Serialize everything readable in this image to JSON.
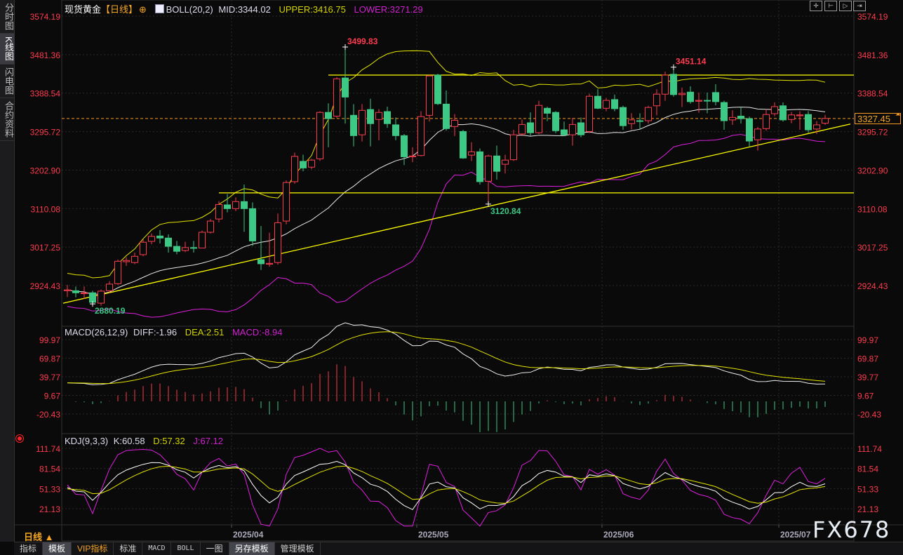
{
  "sidebar": {
    "tabs": [
      {
        "label": "分时图",
        "active": false
      },
      {
        "label": "K线图",
        "active": true
      },
      {
        "label": "闪电图",
        "active": false
      },
      {
        "label": "合约资料",
        "active": false
      }
    ]
  },
  "header": {
    "symbol": "现货黄金",
    "period_tag": "【日线】",
    "boll": {
      "name": "BOLL(20,2)",
      "mid": "MID:3344.02",
      "upper": "UPPER:3416.75",
      "lower": "LOWER:3271.29"
    },
    "macd": {
      "name": "MACD(26,12,9)",
      "diff": "DIFF:-1.96",
      "dea": "DEA:2.51",
      "macd": "MACD:-8.94"
    },
    "kdj": {
      "name": "KDJ(9,3,3)",
      "k": "K:60.58",
      "d": "D:57.32",
      "j": "J:67.12"
    }
  },
  "toolbar": {
    "icons": [
      "crosshair-icon",
      "zoom-left-icon",
      "zoom-right-icon",
      "move-right-icon"
    ]
  },
  "current_price": "3327.45",
  "period_label": "日线 ▲",
  "watermark": "FX678",
  "bottom_tabs": [
    {
      "label": "指标",
      "style": ""
    },
    {
      "label": "模板",
      "style": "hl"
    },
    {
      "label": "VIP指标",
      "style": "vip"
    },
    {
      "label": "标准",
      "style": ""
    },
    {
      "label": "MACD",
      "style": "mono"
    },
    {
      "label": "BOLL",
      "style": "mono"
    },
    {
      "label": "一图",
      "style": ""
    },
    {
      "label": "另存模板",
      "style": "hl"
    },
    {
      "label": "管理模板",
      "style": ""
    }
  ],
  "colors": {
    "up": "#ff3b4e",
    "down": "#3cc985",
    "axis_text": "#ff3b4e",
    "boll_mid": "#e8e8e8",
    "boll_upper": "#e6e600",
    "boll_lower": "#e020e0",
    "trendline": "#ffff00",
    "current_line": "#f59a23",
    "kdj_k": "#ffffff",
    "kdj_d": "#e6e600",
    "kdj_j": "#e020e0"
  },
  "chart_data": [
    {
      "type": "candlestick",
      "title": "现货黄金 日线",
      "y_ticks": [
        "3574.19",
        "3481.36",
        "3388.54",
        "3295.72",
        "3202.90",
        "3110.08",
        "3017.25",
        "2924.43"
      ],
      "x_labels": [
        {
          "index": 20,
          "label": "2025/04"
        },
        {
          "index": 42,
          "label": "2025/05"
        },
        {
          "index": 64,
          "label": "2025/06"
        },
        {
          "index": 85,
          "label": "2025/07"
        }
      ],
      "ohlc": [
        [
          2912,
          2926,
          2897,
          2914
        ],
        [
          2912,
          2922,
          2896,
          2907
        ],
        [
          2905,
          2922,
          2892,
          2907
        ],
        [
          2907,
          2912,
          2880.19,
          2884
        ],
        [
          2882,
          2915,
          2876,
          2911
        ],
        [
          2912,
          2935,
          2906,
          2928
        ],
        [
          2929,
          2987,
          2926,
          2983
        ],
        [
          2982,
          2993,
          2972,
          2985
        ],
        [
          2980,
          3004,
          2976,
          2995
        ],
        [
          2999,
          3036,
          2995,
          3029
        ],
        [
          3031,
          3050,
          3024,
          3043
        ],
        [
          3044,
          3058,
          3026,
          3039
        ],
        [
          3039,
          3048,
          3004,
          3019
        ],
        [
          3019,
          3032,
          3000,
          3007
        ],
        [
          3009,
          3030,
          3005,
          3016
        ],
        [
          3016,
          3032,
          3004,
          3015
        ],
        [
          3015,
          3057,
          3015,
          3053
        ],
        [
          3053,
          3085,
          3050,
          3080
        ],
        [
          3085,
          3128,
          3077,
          3120
        ],
        [
          3119,
          3145,
          3101,
          3110
        ],
        [
          3110,
          3137,
          3104,
          3127
        ],
        [
          3127,
          3168,
          3054,
          3110
        ],
        [
          3110,
          3125,
          3020,
          3032
        ],
        [
          2987,
          3068,
          2962,
          2977
        ],
        [
          2976,
          3052,
          2970,
          2978
        ],
        [
          2980,
          3098,
          2975,
          3076
        ],
        [
          3080,
          3178,
          3072,
          3173
        ],
        [
          3175,
          3245,
          3170,
          3236
        ],
        [
          3224,
          3240,
          3200,
          3208
        ],
        [
          3210,
          3230,
          3205,
          3227
        ],
        [
          3230,
          3345,
          3225,
          3342
        ],
        [
          3342,
          3364,
          3258,
          3327
        ],
        [
          3333,
          3427,
          3328,
          3423
        ],
        [
          3425,
          3499.83,
          3315,
          3379
        ],
        [
          3335,
          3362,
          3260,
          3286
        ],
        [
          3288,
          3362,
          3272,
          3347
        ],
        [
          3349,
          3375,
          3260,
          3315
        ],
        [
          3325,
          3350,
          3275,
          3342
        ],
        [
          3344,
          3356,
          3305,
          3315
        ],
        [
          3312,
          3330,
          3275,
          3286
        ],
        [
          3286,
          3290,
          3215,
          3235
        ],
        [
          3235,
          3258,
          3222,
          3237
        ],
        [
          3238,
          3345,
          3236,
          3332
        ],
        [
          3335,
          3432,
          3320,
          3430
        ],
        [
          3432,
          3435,
          3360,
          3363
        ],
        [
          3362,
          3395,
          3298,
          3303
        ],
        [
          3308,
          3338,
          3285,
          3323
        ],
        [
          3296,
          3300,
          3230,
          3232
        ],
        [
          3239,
          3270,
          3225,
          3247
        ],
        [
          3247,
          3255,
          3168,
          3175
        ],
        [
          3176,
          3240,
          3120.84,
          3237
        ],
        [
          3237,
          3262,
          3180,
          3200
        ],
        [
          3217,
          3240,
          3195,
          3227
        ],
        [
          3228,
          3300,
          3225,
          3288
        ],
        [
          3290,
          3325,
          3285,
          3313
        ],
        [
          3317,
          3342,
          3286,
          3293
        ],
        [
          3293,
          3370,
          3290,
          3359
        ],
        [
          3352,
          3356,
          3321,
          3340
        ],
        [
          3342,
          3345,
          3292,
          3298
        ],
        [
          3300,
          3320,
          3285,
          3288
        ],
        [
          3288,
          3329,
          3262,
          3313
        ],
        [
          3317,
          3330,
          3282,
          3288
        ],
        [
          3296,
          3387,
          3292,
          3381
        ],
        [
          3381,
          3398,
          3350,
          3352
        ],
        [
          3352,
          3377,
          3345,
          3371
        ],
        [
          3373,
          3385,
          3345,
          3351
        ],
        [
          3354,
          3358,
          3300,
          3310
        ],
        [
          3315,
          3340,
          3301,
          3324
        ],
        [
          3322,
          3340,
          3302,
          3321
        ],
        [
          3322,
          3358,
          3315,
          3354
        ],
        [
          3358,
          3398,
          3335,
          3386
        ],
        [
          3386,
          3440,
          3370,
          3432
        ],
        [
          3434,
          3451.14,
          3380,
          3385
        ],
        [
          3385,
          3402,
          3355,
          3388
        ],
        [
          3391,
          3405,
          3363,
          3368
        ],
        [
          3369,
          3390,
          3341,
          3371
        ],
        [
          3371,
          3390,
          3340,
          3370
        ],
        [
          3390,
          3410,
          3359,
          3368
        ],
        [
          3366,
          3370,
          3300,
          3322
        ],
        [
          3324,
          3347,
          3312,
          3330
        ],
        [
          3333,
          3355,
          3315,
          3327
        ],
        [
          3327,
          3332,
          3260,
          3273
        ],
        [
          3276,
          3307,
          3250,
          3302
        ],
        [
          3303,
          3350,
          3298,
          3337
        ],
        [
          3339,
          3366,
          3333,
          3356
        ],
        [
          3358,
          3366,
          3320,
          3324
        ],
        [
          3325,
          3343,
          3316,
          3336
        ],
        [
          3334,
          3345,
          3300,
          3336
        ],
        [
          3337,
          3345,
          3293,
          3300
        ],
        [
          3302,
          3321,
          3290,
          3312
        ],
        [
          3316,
          3336,
          3312,
          3327.45
        ]
      ],
      "annotations": [
        {
          "index": 33,
          "value": "3499.83",
          "kind": "high"
        },
        {
          "index": 72,
          "value": "3451.14",
          "kind": "high"
        },
        {
          "index": 50,
          "value": "3120.84",
          "kind": "low"
        },
        {
          "index": 3,
          "value": "2880.19",
          "kind": "low"
        }
      ],
      "drawn_lines": [
        {
          "kind": "horizontal",
          "price": 3432,
          "from_index": 31
        },
        {
          "kind": "horizontal",
          "price": 3148,
          "from_index": 18
        },
        {
          "kind": "trend",
          "from": [
            0,
            2882
          ],
          "to": [
            93,
            3314
          ]
        }
      ],
      "overlay": "BOLL(20,2)"
    },
    {
      "type": "macd",
      "params": [
        26,
        12,
        9
      ],
      "y_ticks": [
        "99.97",
        "69.87",
        "39.77",
        "9.67",
        "-20.43"
      ]
    },
    {
      "type": "kdj",
      "params": [
        9,
        3,
        3
      ],
      "y_ticks": [
        "111.74",
        "81.54",
        "51.33",
        "21.13"
      ]
    }
  ]
}
